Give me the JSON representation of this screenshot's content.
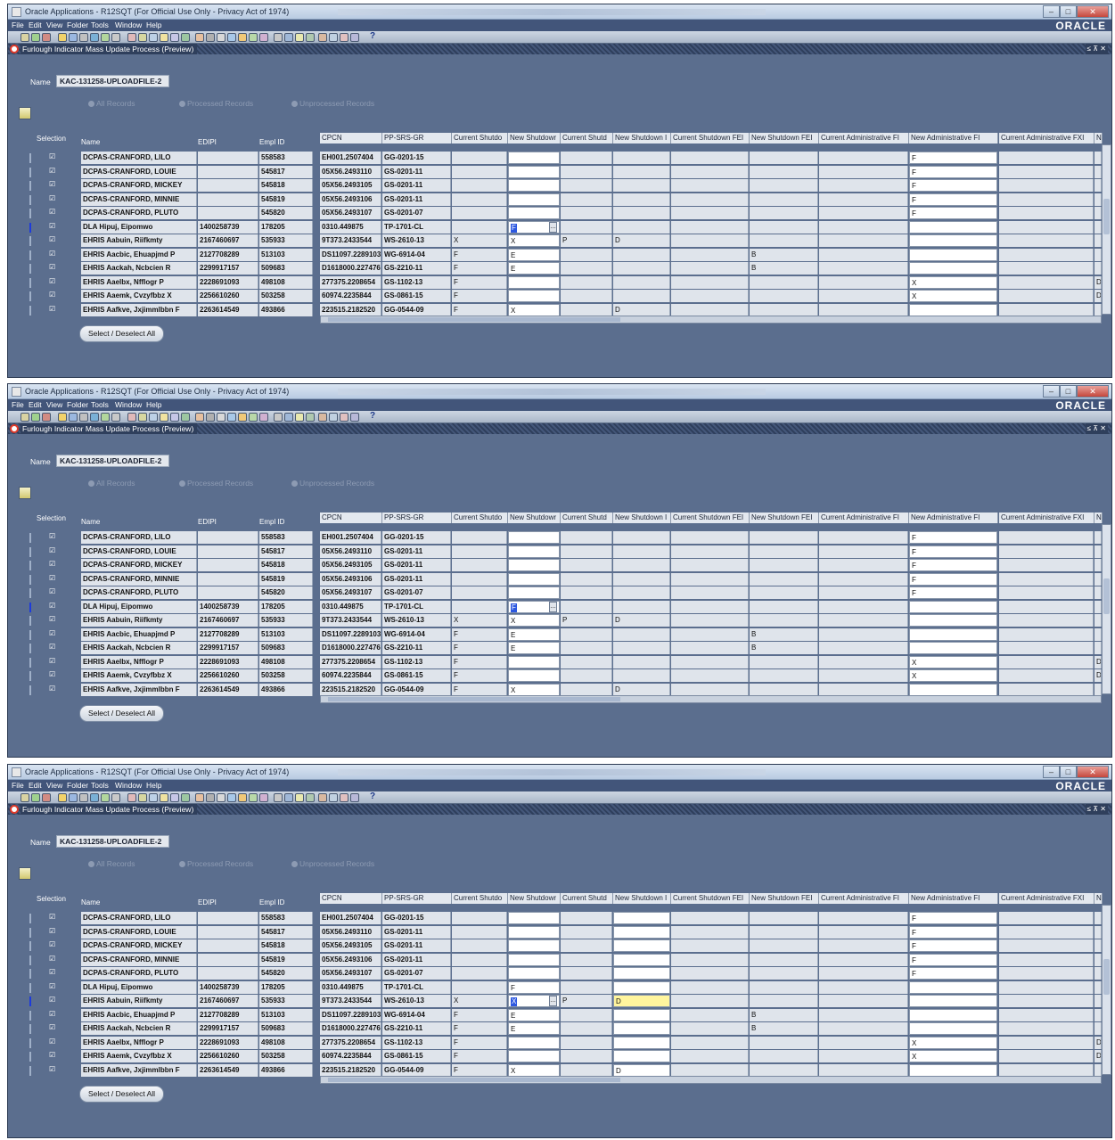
{
  "window": {
    "title": "Oracle Applications - R12SQT (For Official Use Only - Privacy Act of 1974)",
    "logo": "ORACLE",
    "buttons": [
      "–",
      "□",
      "✕"
    ]
  },
  "menu": [
    "File",
    "Edit",
    "View",
    "Folder",
    "Tools",
    "Window",
    "Help"
  ],
  "form": {
    "title": "Furlough Indicator Mass Update Process (Preview)",
    "controls": "≤ ⊼ ✕",
    "name_label": "Name",
    "name_value": "KAC-131258-UPLOADFILE-2",
    "radios": [
      "All Records",
      "Processed Records",
      "Unprocessed Records"
    ],
    "select_button": "Select / Deselect All"
  },
  "columns": {
    "selection": "Selection",
    "name": "Name",
    "edipi": "EDIPI",
    "empl_id": "Empl ID",
    "cpcn": "CPCN",
    "ppsrsgr": "PP-SRS-GR",
    "c1": "Current Shutdo",
    "c2": "New Shutdowr",
    "c3": "Current Shutd",
    "c4": "New Shutdown I",
    "c5": "Current Shutdown FEI",
    "c6": "New Shutdown FEI",
    "c7": "Current Administrative FI",
    "c8": "New Administrative FI",
    "c9": "Current Administrative FXI",
    "c10": "N"
  },
  "help_icon": "?",
  "rows": [
    {
      "name": "DCPAS-CRANFORD, LILO",
      "edipi": "",
      "empl": "558583",
      "cpcn": "EH001.2507404",
      "pp": "GG-0201-15",
      "c1": "",
      "c2": "",
      "c3": "",
      "c4": "",
      "c6": "",
      "c8": "F",
      "c10": ""
    },
    {
      "name": "DCPAS-CRANFORD, LOUIE",
      "edipi": "",
      "empl": "545817",
      "cpcn": "05X56.2493110",
      "pp": "GS-0201-11",
      "c1": "",
      "c2": "",
      "c3": "",
      "c4": "",
      "c6": "",
      "c8": "F",
      "c10": ""
    },
    {
      "name": "DCPAS-CRANFORD, MICKEY",
      "edipi": "",
      "empl": "545818",
      "cpcn": "05X56.2493105",
      "pp": "GS-0201-11",
      "c1": "",
      "c2": "",
      "c3": "",
      "c4": "",
      "c6": "",
      "c8": "F",
      "c10": ""
    },
    {
      "name": "DCPAS-CRANFORD, MINNIE",
      "edipi": "",
      "empl": "545819",
      "cpcn": "05X56.2493106",
      "pp": "GS-0201-11",
      "c1": "",
      "c2": "",
      "c3": "",
      "c4": "",
      "c6": "",
      "c8": "F",
      "c10": ""
    },
    {
      "name": "DCPAS-CRANFORD, PLUTO",
      "edipi": "",
      "empl": "545820",
      "cpcn": "05X56.2493107",
      "pp": "GS-0201-07",
      "c1": "",
      "c2": "",
      "c3": "",
      "c4": "",
      "c6": "",
      "c8": "F",
      "c10": ""
    },
    {
      "name": "DLA Hipuj, Eipomwo",
      "edipi": "1400258739",
      "empl": "178205",
      "cpcn": "0310.449875",
      "pp": "TP-1701-CL",
      "c1": "",
      "c2": "F",
      "c3": "",
      "c4": "",
      "c6": "",
      "c8": "",
      "c10": ""
    },
    {
      "name": "EHRIS Aabuin, Riifkmty",
      "edipi": "2167460697",
      "empl": "535933",
      "cpcn": "9T373.2433544",
      "pp": "WS-2610-13",
      "c1": "X",
      "c2": "X",
      "c3": "P",
      "c4": "D",
      "c6": "",
      "c8": "",
      "c10": ""
    },
    {
      "name": "EHRIS Aacbic, Ehuapjmd P",
      "edipi": "2127708289",
      "empl": "513103",
      "cpcn": "DS11097.2289103",
      "pp": "WG-6914-04",
      "c1": "F",
      "c2": "E",
      "c3": "",
      "c4": "",
      "c6": "B",
      "c8": "",
      "c10": ""
    },
    {
      "name": "EHRIS Aackah, Ncbcien R",
      "edipi": "2299917157",
      "empl": "509683",
      "cpcn": "D1618000.227476",
      "pp": "GS-2210-11",
      "c1": "F",
      "c2": "E",
      "c3": "",
      "c4": "",
      "c6": "B",
      "c8": "",
      "c10": ""
    },
    {
      "name": "EHRIS Aaelbx, Nfflogr P",
      "edipi": "2228691093",
      "empl": "498108",
      "cpcn": "277375.2208654",
      "pp": "GS-1102-13",
      "c1": "F",
      "c2": "",
      "c3": "",
      "c4": "",
      "c6": "",
      "c8": "X",
      "c10": "D"
    },
    {
      "name": "EHRIS Aaemk, Cvzyfbbz X",
      "edipi": "2256610260",
      "empl": "503258",
      "cpcn": "60974.2235844",
      "pp": "GS-0861-15",
      "c1": "F",
      "c2": "",
      "c3": "",
      "c4": "",
      "c6": "",
      "c8": "X",
      "c10": "D"
    },
    {
      "name": "EHRIS Aafkve, Jxjimmlbbn F",
      "edipi": "2263614549",
      "empl": "493866",
      "cpcn": "223515.2182520",
      "pp": "GG-0544-09",
      "c1": "F",
      "c2": "X",
      "c3": "",
      "c4": "D",
      "c6": "",
      "c8": "",
      "c10": ""
    }
  ]
}
